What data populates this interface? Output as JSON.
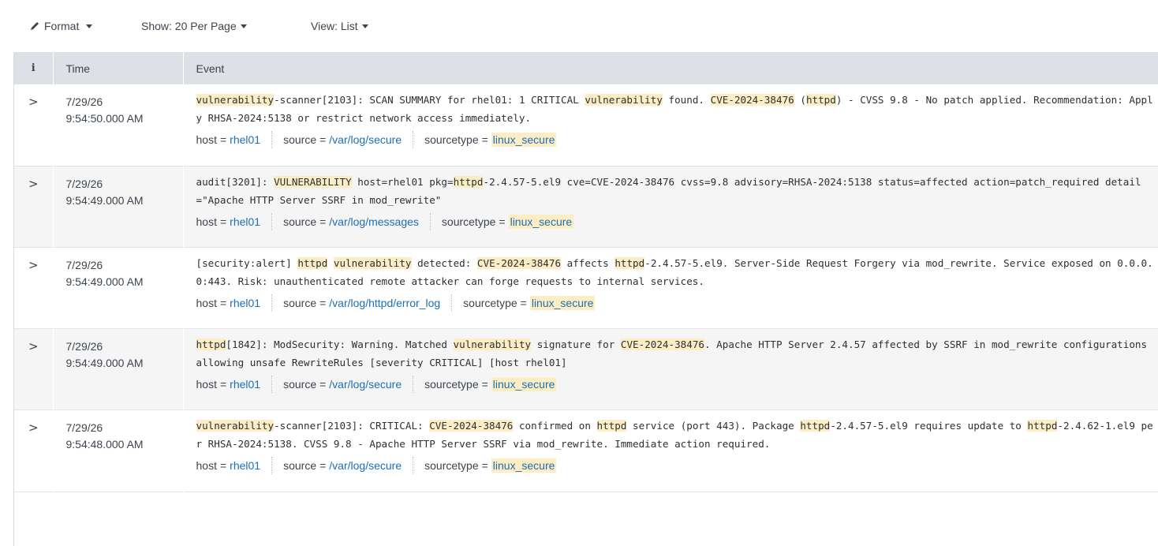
{
  "toolbar": {
    "format_label": "Format",
    "show_label": "Show: 20 Per Page",
    "view_label": "View: List"
  },
  "table": {
    "headers": {
      "info": "i",
      "time": "Time",
      "event": "Event"
    }
  },
  "events": [
    {
      "date": "7/29/26",
      "time": "9:54:50.000 AM",
      "raw": [
        {
          "t": "vulnerability",
          "h": true
        },
        {
          "t": "-scanner[2103]: SCAN SUMMARY for rhel01: 1 CRITICAL ",
          "h": false
        },
        {
          "t": "vulnerability",
          "h": true
        },
        {
          "t": " found. ",
          "h": false
        },
        {
          "t": "CVE-2024-38476",
          "h": true
        },
        {
          "t": " (",
          "h": false
        },
        {
          "t": "httpd",
          "h": true
        },
        {
          "t": ") - CVSS 9.8 - No patch applied. Recommendation: Apply RHSA-2024:5138 or restrict network access immediately.",
          "h": false
        }
      ],
      "fields": {
        "host": "rhel01",
        "source": "/var/log/secure",
        "sourcetype": "linux_secure"
      }
    },
    {
      "date": "7/29/26",
      "time": "9:54:49.000 AM",
      "raw": [
        {
          "t": "audit[3201]: ",
          "h": false
        },
        {
          "t": "VULNERABILITY",
          "h": true
        },
        {
          "t": " host=rhel01 pkg=",
          "h": false
        },
        {
          "t": "httpd",
          "h": true
        },
        {
          "t": "-2.4.57-5.el9 cve=CVE-2024-38476 cvss=9.8 advisory=RHSA-2024:5138 status=affected action=patch_required detail=\"Apache HTTP Server SSRF in mod_rewrite\"",
          "h": false
        }
      ],
      "fields": {
        "host": "rhel01",
        "source": "/var/log/messages",
        "sourcetype": "linux_secure"
      }
    },
    {
      "date": "7/29/26",
      "time": "9:54:49.000 AM",
      "raw": [
        {
          "t": "[security:alert] ",
          "h": false
        },
        {
          "t": "httpd",
          "h": true
        },
        {
          "t": " ",
          "h": false
        },
        {
          "t": "vulnerability",
          "h": true
        },
        {
          "t": " detected: ",
          "h": false
        },
        {
          "t": "CVE-2024-38476",
          "h": true
        },
        {
          "t": " affects ",
          "h": false
        },
        {
          "t": "httpd",
          "h": true
        },
        {
          "t": "-2.4.57-5.el9. Server-Side Request Forgery via mod_rewrite. Service exposed on 0.0.0.0:443. Risk: unauthenticated remote attacker can forge requests to internal services.",
          "h": false
        }
      ],
      "fields": {
        "host": "rhel01",
        "source": "/var/log/httpd/error_log",
        "sourcetype": "linux_secure"
      }
    },
    {
      "date": "7/29/26",
      "time": "9:54:49.000 AM",
      "raw": [
        {
          "t": "httpd",
          "h": true
        },
        {
          "t": "[1842]: ModSecurity: Warning. Matched ",
          "h": false
        },
        {
          "t": "vulnerability",
          "h": true
        },
        {
          "t": " signature for ",
          "h": false
        },
        {
          "t": "CVE-2024-38476",
          "h": true
        },
        {
          "t": ". Apache HTTP Server 2.4.57 affected by SSRF in mod_rewrite configurations allowing unsafe RewriteRules [severity CRITICAL] [host rhel01]",
          "h": false
        }
      ],
      "fields": {
        "host": "rhel01",
        "source": "/var/log/secure",
        "sourcetype": "linux_secure"
      }
    },
    {
      "date": "7/29/26",
      "time": "9:54:48.000 AM",
      "raw": [
        {
          "t": "vulnerability",
          "h": true
        },
        {
          "t": "-scanner[2103]: CRITICAL: ",
          "h": false
        },
        {
          "t": "CVE-2024-38476",
          "h": true
        },
        {
          "t": " confirmed on ",
          "h": false
        },
        {
          "t": "httpd",
          "h": true
        },
        {
          "t": " service (port 443). Package ",
          "h": false
        },
        {
          "t": "httpd",
          "h": true
        },
        {
          "t": "-2.4.57-5.el9 requires update to ",
          "h": false
        },
        {
          "t": "httpd",
          "h": true
        },
        {
          "t": "-2.4.62-1.el9 per RHSA-2024:5138. CVSS 9.8 - Apache HTTP Server SSRF via mod_rewrite. Immediate action required.",
          "h": false
        }
      ],
      "fields": {
        "host": "rhel01",
        "source": "/var/log/secure",
        "sourcetype": "linux_secure"
      }
    }
  ],
  "labels": {
    "expand": ">",
    "host": "host",
    "source": "source",
    "sourcetype": "sourcetype",
    "eq": "="
  },
  "colors": {
    "highlight": "#fdedc4",
    "link": "#1a6fb7",
    "header_bg": "#dde1e5",
    "row_shade": "#f5f5f5"
  }
}
